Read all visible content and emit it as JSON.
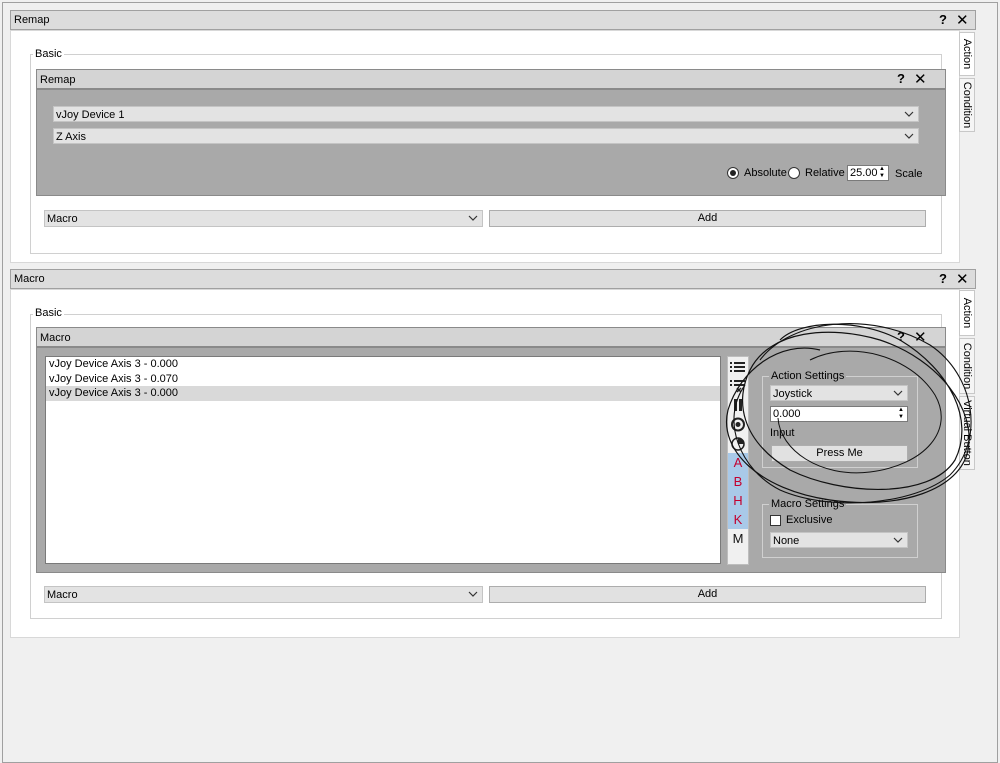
{
  "remap_panel": {
    "title": "Remap",
    "help": "?",
    "close": "✕",
    "group_label": "Basic",
    "inner": {
      "title": "Remap",
      "help": "?",
      "close": "✕",
      "device_select": "vJoy Device 1",
      "axis_select": "Z Axis",
      "absolute_label": "Absolute",
      "relative_label": "Relative",
      "absolute_checked": true,
      "scale_value": "25.00",
      "scale_label": "Scale"
    },
    "action_select": "Macro",
    "add_button": "Add",
    "tabs": [
      "Action",
      "Condition"
    ]
  },
  "macro_panel": {
    "title": "Macro",
    "help": "?",
    "close": "✕",
    "group_label": "Basic",
    "inner": {
      "title": "Macro",
      "help": "?",
      "close": "✕",
      "list_items": [
        "vJoy Device Axis 3 - 0.000",
        "vJoy Device Axis 3 - 0.070",
        "vJoy Device Axis 3 - 0.000"
      ],
      "selected_index": 2,
      "tools": [
        {
          "icon": "list-add-icon"
        },
        {
          "icon": "list-remove-icon"
        },
        {
          "icon": "pause-icon"
        },
        {
          "icon": "record-icon"
        },
        {
          "icon": "timer-icon"
        },
        {
          "icon": "letter-a-icon",
          "text": "A"
        },
        {
          "icon": "letter-b-icon",
          "text": "B"
        },
        {
          "icon": "letter-h-icon",
          "text": "H"
        },
        {
          "icon": "letter-k-icon",
          "text": "K"
        },
        {
          "icon": "letter-m-icon",
          "text": "M"
        }
      ],
      "action_settings": {
        "legend": "Action Settings",
        "type_select": "Joystick",
        "value": "0.000",
        "input_label": "Input",
        "press_button": "Press Me"
      },
      "macro_settings": {
        "legend": "Macro Settings",
        "exclusive_label": "Exclusive",
        "exclusive_checked": false,
        "mode_select": "None"
      }
    },
    "action_select": "Macro",
    "add_button": "Add",
    "tabs": [
      "Action",
      "Condition",
      "Virtual Button"
    ]
  },
  "colors": {
    "title_bg": "#dcdcdc",
    "inner_body_bg": "#a9a9a9",
    "highlight": "#a9c9e8",
    "letter_red": "#c3002f"
  }
}
